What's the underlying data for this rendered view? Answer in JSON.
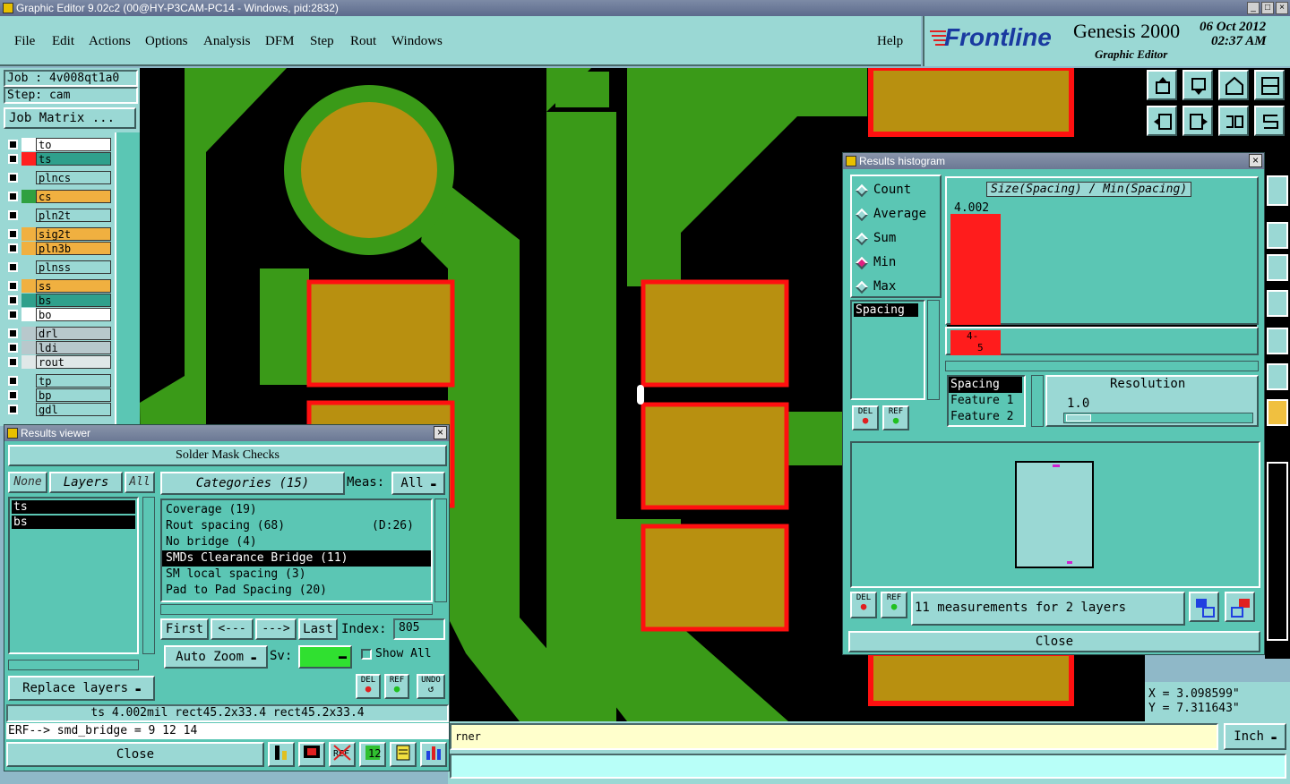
{
  "window": {
    "title": "Graphic Editor 9.02c2 (00@HY-P3CAM-PC14 - Windows, pid:2832)"
  },
  "menu": {
    "items": [
      "File",
      "Edit",
      "Actions",
      "Options",
      "Analysis",
      "DFM",
      "Step",
      "Rout",
      "Windows"
    ],
    "help": "Help"
  },
  "brand": {
    "logo": "Frontline",
    "product": "Genesis 2000",
    "subtitle": "Graphic Editor",
    "date": "06 Oct 2012",
    "time": "02:37 AM"
  },
  "job": {
    "job_label": "Job : 4v008qt1a0",
    "step_label": "Step: cam",
    "matrix_button": "Job Matrix ..."
  },
  "layers": [
    {
      "name": "to",
      "color": "#ffffff",
      "sw": "#ffffff"
    },
    {
      "name": "ts",
      "color": "#2fa08c",
      "sw": "#ff2020"
    },
    {
      "name": "plncs",
      "color": "#9ad8d4",
      "sw": "#9ad8d4"
    },
    {
      "name": "cs",
      "color": "#f0b040",
      "sw": "#2fa040"
    },
    {
      "name": "pln2t",
      "color": "#9ad8d4",
      "sw": "#9ad8d4"
    },
    {
      "name": "sig2t",
      "color": "#f0b040",
      "sw": "#f0b040"
    },
    {
      "name": "pln3b",
      "color": "#f0b040",
      "sw": "#f0b040"
    },
    {
      "name": "plnss",
      "color": "#9ad8d4",
      "sw": "#9ad8d4"
    },
    {
      "name": "ss",
      "color": "#f0b040",
      "sw": "#f0b040"
    },
    {
      "name": "bs",
      "color": "#2fa08c",
      "sw": "#2fa08c"
    },
    {
      "name": "bo",
      "color": "#ffffff",
      "sw": "#ffffff"
    },
    {
      "name": "drl",
      "color": "#b8c8cc",
      "sw": "#b8c8cc"
    },
    {
      "name": "ldi",
      "color": "#b8c8cc",
      "sw": "#b8c8cc"
    },
    {
      "name": "rout",
      "color": "#e0e8e8",
      "sw": "#e0e8e8"
    },
    {
      "name": "tp",
      "color": "#9ad8d4",
      "sw": "#9ad8d4"
    },
    {
      "name": "bp",
      "color": "#9ad8d4",
      "sw": "#9ad8d4"
    },
    {
      "name": "gdl",
      "color": "#9ad8d4",
      "sw": "#9ad8d4"
    }
  ],
  "results_viewer": {
    "title": "Results viewer",
    "header": "Solder Mask Checks",
    "none_btn": "None",
    "layers_btn": "Layers",
    "all_btn": "All",
    "categories_btn": "Categories (15)",
    "meas_label": "Meas:",
    "meas_value": "All",
    "layer_list": [
      "ts",
      "bs"
    ],
    "categories": [
      {
        "label": "Coverage (19)",
        "extra": ""
      },
      {
        "label": "Rout spacing (68)",
        "extra": "(D:26)"
      },
      {
        "label": "No bridge (4)",
        "extra": ""
      },
      {
        "label": "SMDs Clearance Bridge (11)",
        "extra": ""
      },
      {
        "label": "SM local spacing (3)",
        "extra": ""
      },
      {
        "label": "Pad to Pad Spacing (20)",
        "extra": ""
      }
    ],
    "first_btn": "First",
    "prev_btn": "<---",
    "next_btn": "--->",
    "last_btn": "Last",
    "index_label": "Index:",
    "index_value": "805",
    "autozoom_btn": "Auto Zoom",
    "sv_label": "Sv:",
    "show_all": "Show All",
    "replace_btn": "Replace layers",
    "del": "DEL",
    "ref": "REF",
    "undo": "UNDO",
    "status": "ts 4.002mil  rect45.2x33.4  rect45.2x33.4",
    "erf": "ERF--> smd_bridge = 9 12 14",
    "close_btn": "Close"
  },
  "histogram": {
    "title": "Results histogram",
    "options": [
      "Count",
      "Average",
      "Sum",
      "Min",
      "Max"
    ],
    "selected": "Min",
    "metric_list": [
      "Spacing"
    ],
    "chart_title": "Size(Spacing) / Min(Spacing)",
    "bar_value": "4.002",
    "bar_label_a": "4-",
    "bar_label_b": "5",
    "sort_list": [
      "Spacing",
      "Feature 1",
      "Feature 2"
    ],
    "resolution_label": "Resolution",
    "resolution_value": "1.0",
    "measurements": "11 measurements for 2 layers",
    "del": "DEL",
    "ref": "REF",
    "close_btn": "Close"
  },
  "coords": {
    "x": "X = 3.098599\"",
    "y": "Y = 7.311643\""
  },
  "bottom": {
    "message": "rner",
    "units": "Inch"
  }
}
